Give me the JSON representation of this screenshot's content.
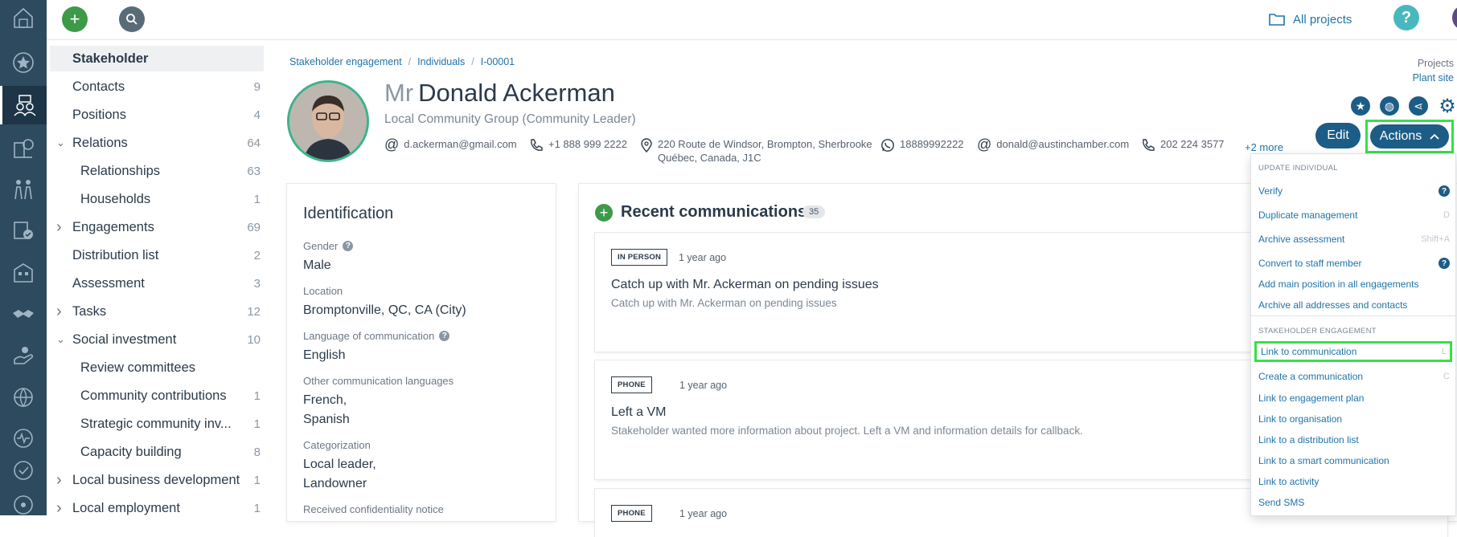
{
  "leftbar": {
    "icons": [
      "home-icon",
      "star-icon",
      "stakeholder-icon",
      "landscape-icon",
      "people-icon",
      "document-check-icon",
      "buildings-icon",
      "handshake-icon",
      "hand-icon",
      "globe-people-icon",
      "activity-icon",
      "check-circle-icon",
      "location-icon"
    ]
  },
  "topbar": {
    "all_projects": "All projects",
    "help": "?"
  },
  "sidenav": {
    "items": [
      {
        "label": "Stakeholder",
        "count": "",
        "selected": true,
        "indent": 0,
        "chevron": ""
      },
      {
        "label": "Contacts",
        "count": "9",
        "indent": 0,
        "chevron": ""
      },
      {
        "label": "Positions",
        "count": "4",
        "indent": 0,
        "chevron": ""
      },
      {
        "label": "Relations",
        "count": "64",
        "indent": 0,
        "chevron": "down"
      },
      {
        "label": "Relationships",
        "count": "63",
        "indent": 1,
        "chevron": ""
      },
      {
        "label": "Households",
        "count": "1",
        "indent": 1,
        "chevron": ""
      },
      {
        "label": "Engagements",
        "count": "69",
        "indent": 0,
        "chevron": "right"
      },
      {
        "label": "Distribution list",
        "count": "2",
        "indent": 0,
        "chevron": ""
      },
      {
        "label": "Assessment",
        "count": "3",
        "indent": 0,
        "chevron": ""
      },
      {
        "label": "Tasks",
        "count": "12",
        "indent": 0,
        "chevron": "right"
      },
      {
        "label": "Social investment",
        "count": "10",
        "indent": 0,
        "chevron": "down"
      },
      {
        "label": "Review committees",
        "count": "",
        "indent": 1,
        "chevron": ""
      },
      {
        "label": "Community contributions",
        "count": "1",
        "indent": 1,
        "chevron": ""
      },
      {
        "label": "Strategic community inv...",
        "count": "1",
        "indent": 1,
        "chevron": ""
      },
      {
        "label": "Capacity building",
        "count": "8",
        "indent": 1,
        "chevron": ""
      },
      {
        "label": "Local business development",
        "count": "1",
        "indent": 0,
        "chevron": "right"
      },
      {
        "label": "Local employment",
        "count": "1",
        "indent": 0,
        "chevron": "right"
      }
    ]
  },
  "breadcrumb": {
    "a": "Stakeholder engagement",
    "b": "Individuals",
    "c": "I-00001",
    "sep": "/"
  },
  "projects": {
    "heading": "Projects",
    "value": "Plant site"
  },
  "header": {
    "title_prefix": "Mr",
    "name": "Donald Ackerman",
    "subtitle": "Local Community Group (Community Leader)",
    "contacts": {
      "email1": "d.ackerman@gmail.com",
      "phone1": "+1 888 999 2222",
      "address_line1": "220 Route de Windsor, Brompton, Sherbrooke",
      "address_line2": "Québec, Canada, J1C",
      "whatsapp": "18889992222",
      "email2": "donald@austinchamber.com",
      "phone2": "202 224 3577"
    },
    "more": "+2 more",
    "edit_label": "Edit",
    "actions_label": "Actions"
  },
  "identification": {
    "title": "Identification",
    "gender_label": "Gender",
    "gender": "Male",
    "location_label": "Location",
    "location": "Bromptonville, QC, CA (City)",
    "language_label": "Language of communication",
    "language": "English",
    "other_lang_label": "Other communication languages",
    "other_lang_1": "French,",
    "other_lang_2": "Spanish",
    "categorization_label": "Categorization",
    "cat_1": "Local leader,",
    "cat_2": "Landowner",
    "notice_label": "Received confidentiality notice"
  },
  "communications": {
    "title": "Recent communications",
    "count": "35",
    "items": [
      {
        "tag": "IN PERSON",
        "ago": "1 year ago",
        "title": "Catch up with Mr. Ackerman on pending issues",
        "desc": "Catch up with Mr. Ackerman on pending issues"
      },
      {
        "tag": "PHONE",
        "ago": "1 year ago",
        "title": "Left a VM",
        "desc": "Stakeholder wanted more information about project. Left a VM and information details for callback."
      },
      {
        "tag": "PHONE",
        "ago": "1 year ago",
        "title": "",
        "desc": ""
      }
    ]
  },
  "menu": {
    "section1": "UPDATE INDIVIDUAL",
    "verify": "Verify",
    "duplicate": "Duplicate management",
    "duplicate_sc": "D",
    "archive_assessment": "Archive assessment",
    "archive_assessment_sc": "Shift+A",
    "convert": "Convert to staff member",
    "add_main": "Add main position in all engagements",
    "archive_all": "Archive all addresses and contacts",
    "section2": "STAKEHOLDER ENGAGEMENT",
    "link_comm": "Link to communication",
    "link_comm_sc": "L",
    "create_comm": "Create a communication",
    "create_comm_sc": "C",
    "link_plan": "Link to engagement plan",
    "link_org": "Link to organisation",
    "link_dist": "Link to a distribution list",
    "link_smart": "Link to a smart communication",
    "link_activity": "Link to activity",
    "send_sms": "Send SMS",
    "qmark": "?"
  }
}
